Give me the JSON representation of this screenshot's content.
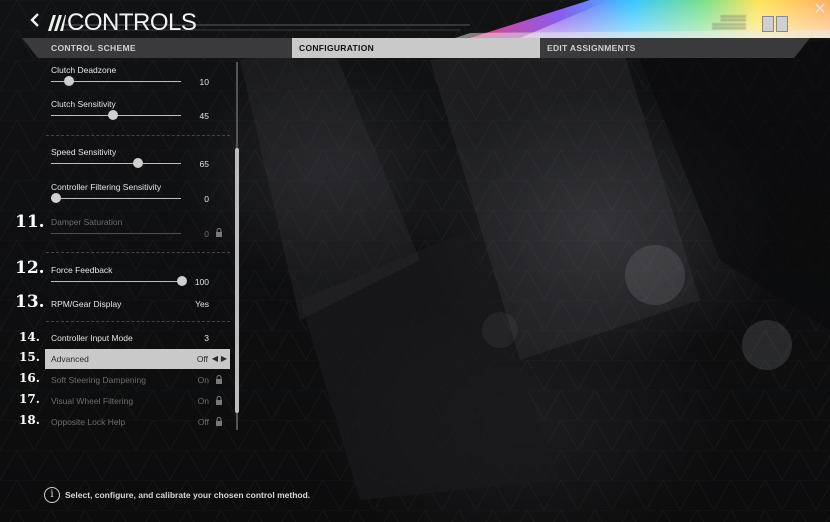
{
  "header": {
    "title": "CONTROLS",
    "user_lines": [
      "▒▒▒▒▒▒",
      "▒▒▒▒▒▒▒▒"
    ]
  },
  "tabs": [
    {
      "label": "CONTROL SCHEME",
      "active": false
    },
    {
      "label": "CONFIGURATION",
      "active": true
    },
    {
      "label": "EDIT ASSIGNMENTS",
      "active": false
    }
  ],
  "settings": [
    {
      "label": "Clutch Deadzone",
      "value": "10",
      "type": "slider",
      "level": 0.1,
      "enabled": true,
      "number": ""
    },
    {
      "label": "Clutch Sensitivity",
      "value": "45",
      "type": "slider",
      "level": 0.45,
      "enabled": true,
      "number": ""
    },
    {
      "label": "Speed Sensitivity",
      "value": "65",
      "type": "slider",
      "level": 0.65,
      "enabled": true,
      "number": ""
    },
    {
      "label": "Controller Filtering Sensitivity",
      "value": "0",
      "type": "slider",
      "level": 0.0,
      "enabled": true,
      "number": ""
    },
    {
      "label": "Damper Saturation",
      "value": "0",
      "type": "slider",
      "level": 0.0,
      "enabled": false,
      "number": "11."
    },
    {
      "label": "Force Feedback",
      "value": "100",
      "type": "slider",
      "level": 1.0,
      "enabled": true,
      "number": "12."
    },
    {
      "label": "RPM/Gear Display",
      "value": "Yes",
      "type": "toggle",
      "enabled": true,
      "number": "13."
    },
    {
      "label": "Controller Input Mode",
      "value": "3",
      "type": "toggle",
      "enabled": true,
      "number": "14."
    },
    {
      "label": "Advanced",
      "value": "Off",
      "type": "selector",
      "enabled": true,
      "selected": true,
      "number": "15."
    },
    {
      "label": "Soft Steering Dampening",
      "value": "On",
      "type": "toggle",
      "enabled": false,
      "number": "16."
    },
    {
      "label": "Visual Wheel Filtering",
      "value": "On",
      "type": "toggle",
      "enabled": false,
      "number": "17."
    },
    {
      "label": "Opposite Lock Help",
      "value": "Off",
      "type": "toggle",
      "enabled": false,
      "number": "18."
    }
  ],
  "footer": {
    "info_text": "Select, configure, and calibrate your chosen control method."
  },
  "icons": {
    "back": "chevron-left-icon",
    "logo": "forza-logo-icon",
    "close": "close-icon",
    "lock": "lock-icon",
    "info": "info-icon",
    "arrows": "arrow-left-right-icon"
  },
  "colors": {
    "background": "#0c0c0d",
    "active_tab": "#c9c9c9",
    "inactive_tab": "#3a3a3c",
    "text": "#e4e4e4",
    "disabled_text": "#6c6c6c"
  }
}
